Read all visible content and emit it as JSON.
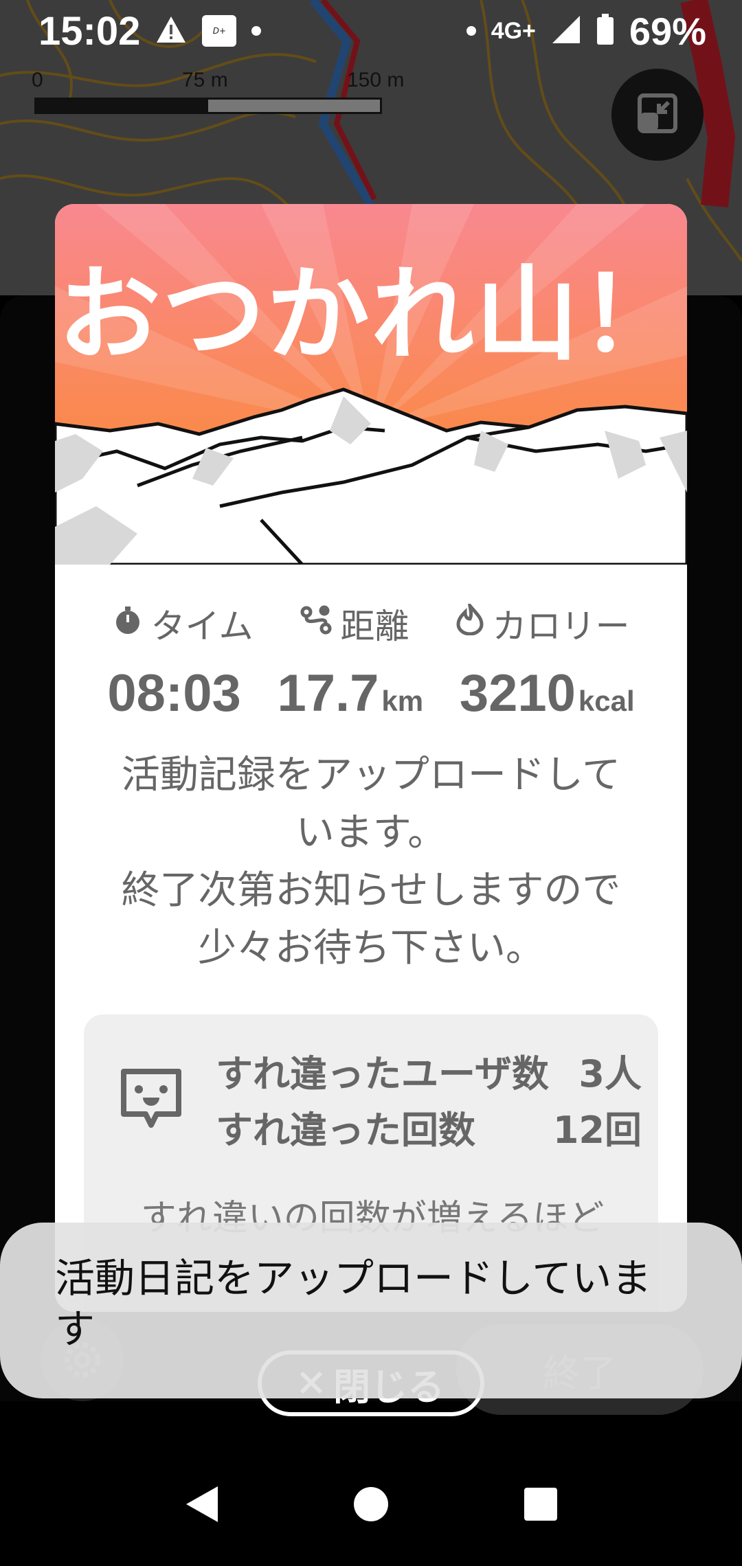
{
  "status_bar": {
    "time": "15:02",
    "network": "4G+",
    "battery": "69%",
    "icons": [
      "warning-icon",
      "disney-icon",
      "notification-dot",
      "signal-icon",
      "battery-icon"
    ]
  },
  "map": {
    "scale_labels": [
      "0",
      "75 m",
      "150 m"
    ]
  },
  "dialog": {
    "banner_title": "おつかれ山！",
    "stats": [
      {
        "label": "タイム",
        "value": "08:03",
        "unit": "",
        "icon": "stopwatch-icon"
      },
      {
        "label": "距離",
        "value": "17.7",
        "unit": "km",
        "icon": "route-icon"
      },
      {
        "label": "カロリー",
        "value": "3210",
        "unit": "kcal",
        "icon": "flame-icon"
      }
    ],
    "message": [
      "活動記録をアップロードして",
      "います。",
      "終了次第お知らせしますので",
      "少々お待ち下さい。"
    ],
    "passing": {
      "users_label": "すれ違ったユーザ数",
      "users_value": "3人",
      "count_label": "すれ違った回数",
      "count_value": "12回",
      "description": "すれ違いの回数が増えるほど"
    },
    "close_label": "閉じる"
  },
  "footer": {
    "end_label": "終了"
  },
  "toast": {
    "text": "活動日記をアップロードしています"
  },
  "colors": {
    "banner_top": "#f98890",
    "banner_bottom": "#fb8a25",
    "route_blue": "#3d7fd0",
    "route_red": "#d21f2f"
  }
}
